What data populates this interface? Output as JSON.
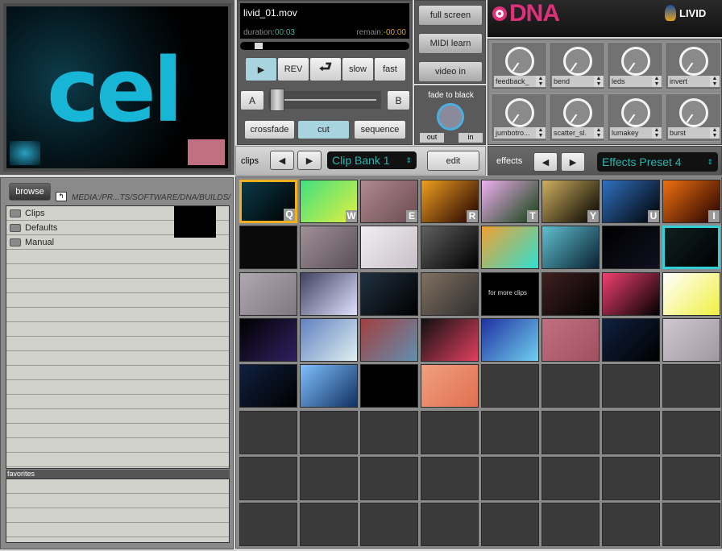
{
  "preview": {
    "logo_text": "cel"
  },
  "clip_info": {
    "filename": "livid_01.mov",
    "duration_label": "duration:",
    "duration": "00:03",
    "remain_label": "remain:",
    "remain": "-00:00"
  },
  "transport": {
    "play": "▶",
    "rev": "REV",
    "loop": "⮐",
    "slow": "slow",
    "fast": "fast"
  },
  "crossfader": {
    "a": "A",
    "b": "B",
    "position": 0.05
  },
  "modes": {
    "crossfade": "crossfade",
    "cut": "cut",
    "sequence": "sequence"
  },
  "right_buttons": {
    "full_screen": "full screen",
    "midi_learn": "MIDI learn",
    "video_in": "video in"
  },
  "fade": {
    "title": "fade to black",
    "out": "out",
    "in": "in"
  },
  "brand": {
    "dna": "DNA",
    "livid": "LIVID"
  },
  "effects_knobs": [
    {
      "label": "feedback_"
    },
    {
      "label": "bend"
    },
    {
      "label": "leds"
    },
    {
      "label": "invert"
    },
    {
      "label": "jumbotro..."
    },
    {
      "label": "scatter_sl."
    },
    {
      "label": "lumakey"
    },
    {
      "label": "burst"
    }
  ],
  "clips_bar": {
    "label": "clips",
    "bank": "Clip Bank 1",
    "edit": "edit"
  },
  "effects_bar": {
    "label": "effects",
    "preset": "Effects Preset 4"
  },
  "browser": {
    "browse": "browse",
    "path": "MEDIA:/PR...TS/SOFTWARE/DNA/BUILDS/",
    "folders": [
      "Clips",
      "Defaults",
      "Manual"
    ],
    "favorites_label": "favorites"
  },
  "clip_grid": {
    "keys": [
      "Q",
      "W",
      "E",
      "R",
      "T",
      "Y",
      "U",
      "I"
    ],
    "thumbs": [
      {
        "c": "#0a3a48,#000"
      },
      {
        "c": "#40e080,#e0f040"
      },
      {
        "c": "#b08a90,#6a4a50"
      },
      {
        "c": "#f0a020,#200000"
      },
      {
        "c": "#f0b0f0,#104010"
      },
      {
        "c": "#d0b060,#000"
      },
      {
        "c": "#3070c0,#000"
      },
      {
        "c": "#f07010,#200000"
      },
      {
        "c": "#0a0a0a,#0a0a0a"
      },
      {
        "c": "#a09098,#5a5058"
      },
      {
        "c": "#f0eef0,#c8c0c8"
      },
      {
        "c": "#606060,#000"
      },
      {
        "c": "#f0a030,#30e0d0"
      },
      {
        "c": "#60c0d0,#0a2030"
      },
      {
        "c": "#000,#101020"
      },
      {
        "c": "#102020,#000"
      },
      {
        "c": "#b0a8b0,#807880"
      },
      {
        "c": "#404060,#e0e0ff"
      },
      {
        "c": "#203040,#000"
      },
      {
        "c": "#807060,#303030"
      },
      {
        "c": "#000,#000",
        "text": "for more clips"
      },
      {
        "c": "#402020,#000"
      },
      {
        "c": "#f04070,#000"
      },
      {
        "c": "#ffffff,#f0f040"
      },
      {
        "c": "#000,#302060"
      },
      {
        "c": "#6080c0,#e0f0f0"
      },
      {
        "c": "#a04040,#6090b0"
      },
      {
        "c": "#101010,#e04060"
      },
      {
        "c": "#2030a0,#70d0f0"
      },
      {
        "c": "#c07080,#a05060"
      },
      {
        "c": "#102040,#000"
      },
      {
        "c": "#d0c8d0,#a098a0"
      },
      {
        "c": "#102040,#000"
      },
      {
        "c": "#80c0ff,#103060"
      },
      {
        "c": "#000,#000"
      },
      {
        "c": "#f0a080,#e07050"
      }
    ],
    "total_cells": 64,
    "selected_index": 0,
    "active_index": 15
  },
  "colors": {
    "accent": "#27b6b0",
    "dna_pink": "#e0307a",
    "active_blue": "#a8d4e0"
  }
}
